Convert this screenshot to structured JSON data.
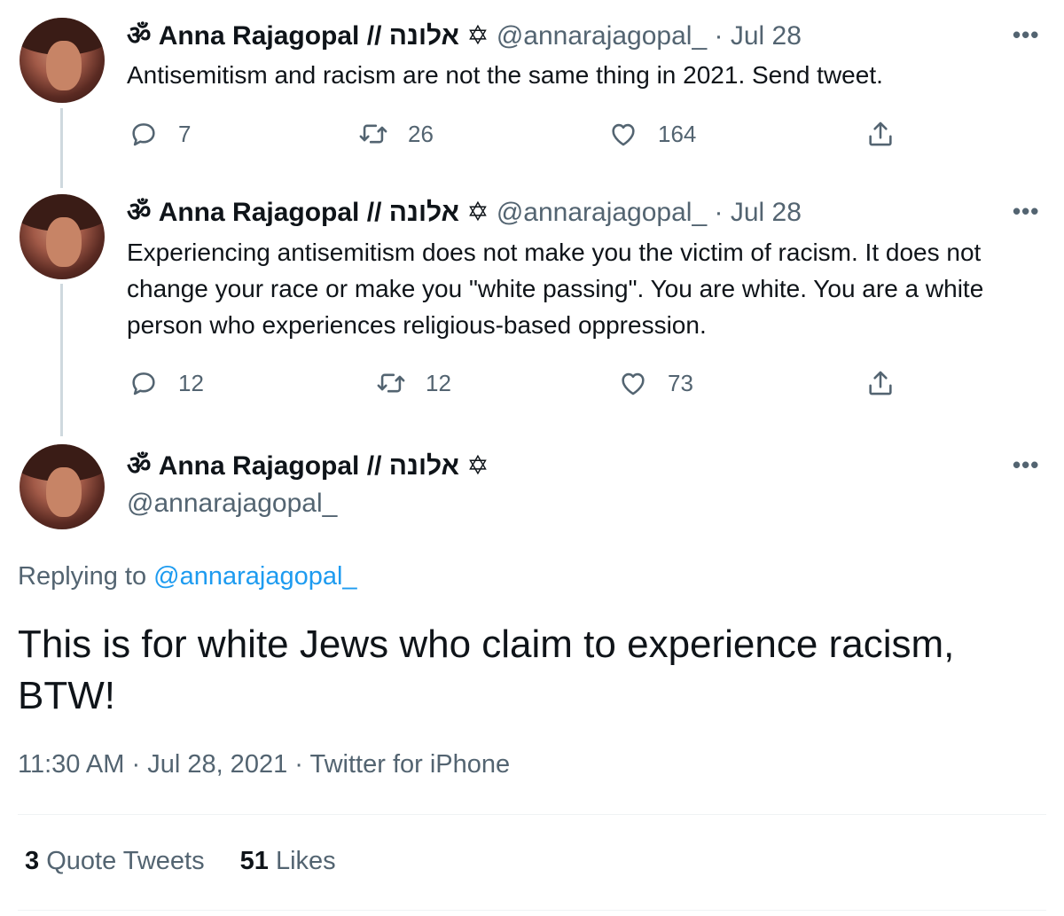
{
  "tweets": [
    {
      "name": "ॐ Anna Rajagopal // אלונה ✡",
      "handle": "@annarajagopal_",
      "separator": "·",
      "date": "Jul 28",
      "text": "Antisemitism and racism are not the same thing in 2021. Send tweet.",
      "replies": "7",
      "retweets": "26",
      "likes": "164",
      "more": "•••"
    },
    {
      "name": "ॐ Anna Rajagopal // אלונה ✡",
      "handle": "@annarajagopal_",
      "separator": "·",
      "date": "Jul 28",
      "text": "Experiencing antisemitism does not make you the victim of racism. It does not change your race or make you \"white passing\". You are white. You are a white person who experiences religious-based oppression.",
      "replies": "12",
      "retweets": "12",
      "likes": "73",
      "more": "•••"
    }
  ],
  "main_tweet": {
    "name": "ॐ Anna Rajagopal // אלונה ✡",
    "handle": "@annarajagopal_",
    "more": "•••",
    "replying_label": "Replying to",
    "replying_handle": "@annarajagopal_",
    "text": "This is for white Jews who claim to experience racism, BTW!",
    "time": "11:30 AM",
    "separator": "·",
    "date": "Jul 28, 2021",
    "source": "Twitter for iPhone",
    "quote_count": "3",
    "quote_label": "Quote Tweets",
    "likes_count": "51",
    "likes_label": "Likes"
  },
  "icons": [
    "reply-icon",
    "retweet-icon",
    "like-icon",
    "share-icon",
    "more-icon"
  ],
  "colors": {
    "text": "#0f1419",
    "secondary": "#536471",
    "link": "#1d9bf0",
    "line": "#cfd9de"
  }
}
